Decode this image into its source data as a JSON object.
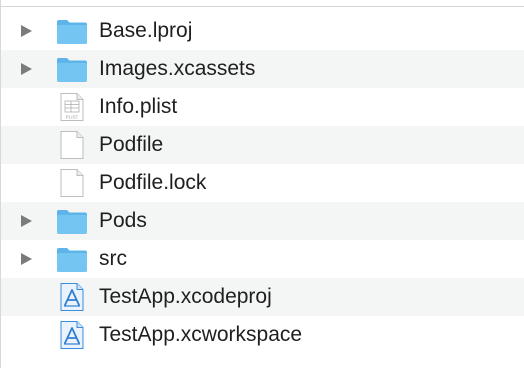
{
  "file_list": {
    "items": [
      {
        "name": "Base.lproj",
        "kind": "folder",
        "expandable": true,
        "icon": "folder-icon"
      },
      {
        "name": "Images.xcassets",
        "kind": "folder",
        "expandable": true,
        "icon": "folder-icon"
      },
      {
        "name": "Info.plist",
        "kind": "plist",
        "expandable": false,
        "icon": "plist-file-icon",
        "icon_text": "PLIST"
      },
      {
        "name": "Podfile",
        "kind": "file",
        "expandable": false,
        "icon": "document-icon"
      },
      {
        "name": "Podfile.lock",
        "kind": "file",
        "expandable": false,
        "icon": "document-icon"
      },
      {
        "name": "Pods",
        "kind": "folder",
        "expandable": true,
        "icon": "folder-icon"
      },
      {
        "name": "src",
        "kind": "folder",
        "expandable": true,
        "icon": "folder-icon"
      },
      {
        "name": "TestApp.xcodeproj",
        "kind": "xcode",
        "expandable": false,
        "icon": "xcode-project-icon"
      },
      {
        "name": "TestApp.xcworkspace",
        "kind": "xcode",
        "expandable": false,
        "icon": "xcode-workspace-icon"
      }
    ]
  },
  "colors": {
    "folder_fill": "#74c5f2",
    "folder_tab": "#5cb4e8",
    "row_alt": "#f4f5f5",
    "disclosure": "#7b7b7b",
    "text": "#1f1f1f",
    "xcode_blue": "#3a8ee0"
  }
}
